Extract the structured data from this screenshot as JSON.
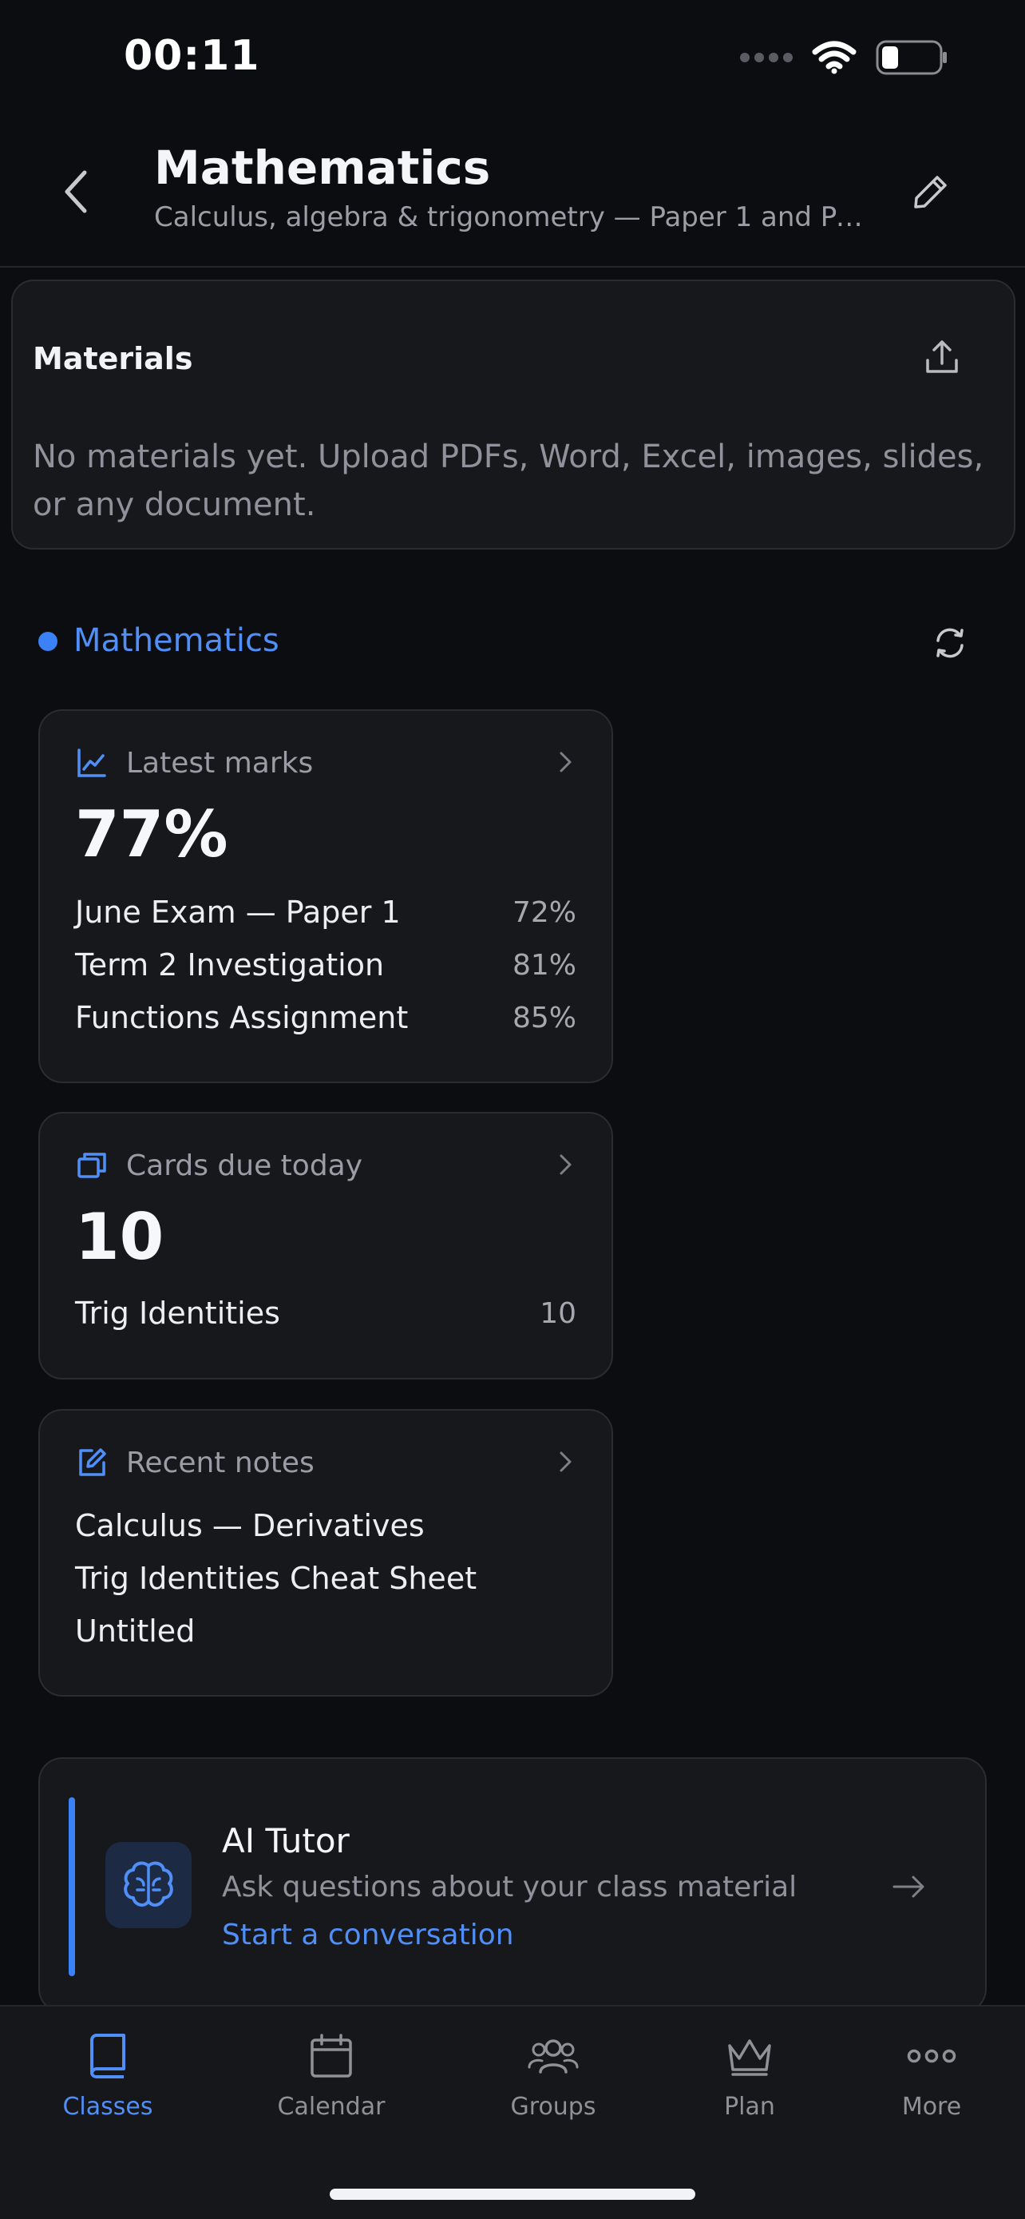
{
  "status_bar": {
    "time": "00:11"
  },
  "header": {
    "title": "Mathematics",
    "subtitle": "Calculus, algebra & trigonometry — Paper 1 and Pa..."
  },
  "materials": {
    "title": "Materials",
    "empty_text": "No materials yet. Upload PDFs, Word, Excel, images, slides, or any document."
  },
  "section": {
    "label": "Mathematics",
    "dot_color": "#3b82f6"
  },
  "latest_marks": {
    "label": "Latest marks",
    "value": "77%",
    "items": [
      {
        "name": "June Exam — Paper 1",
        "score": "72%"
      },
      {
        "name": "Term 2 Investigation",
        "score": "81%"
      },
      {
        "name": "Functions Assignment",
        "score": "85%"
      }
    ]
  },
  "cards_due": {
    "label": "Cards due today",
    "value": "10",
    "items": [
      {
        "name": "Trig Identities",
        "count": "10"
      }
    ]
  },
  "recent_notes": {
    "label": "Recent notes",
    "items": [
      "Calculus — Derivatives",
      "Trig Identities Cheat Sheet",
      "Untitled"
    ]
  },
  "ai_tutor": {
    "title": "AI Tutor",
    "description": "Ask questions about your class material",
    "link": "Start a conversation"
  },
  "tabbar": {
    "tabs": [
      {
        "label": "Classes",
        "icon": "book-icon",
        "active": true
      },
      {
        "label": "Calendar",
        "icon": "calendar-icon",
        "active": false
      },
      {
        "label": "Groups",
        "icon": "users-icon",
        "active": false
      },
      {
        "label": "Plan",
        "icon": "crown-icon",
        "active": false
      },
      {
        "label": "More",
        "icon": "ellipsis-icon",
        "active": false
      }
    ]
  },
  "colors": {
    "accent": "#3b82f6",
    "background": "#0c0d10",
    "card": "#17181c"
  }
}
